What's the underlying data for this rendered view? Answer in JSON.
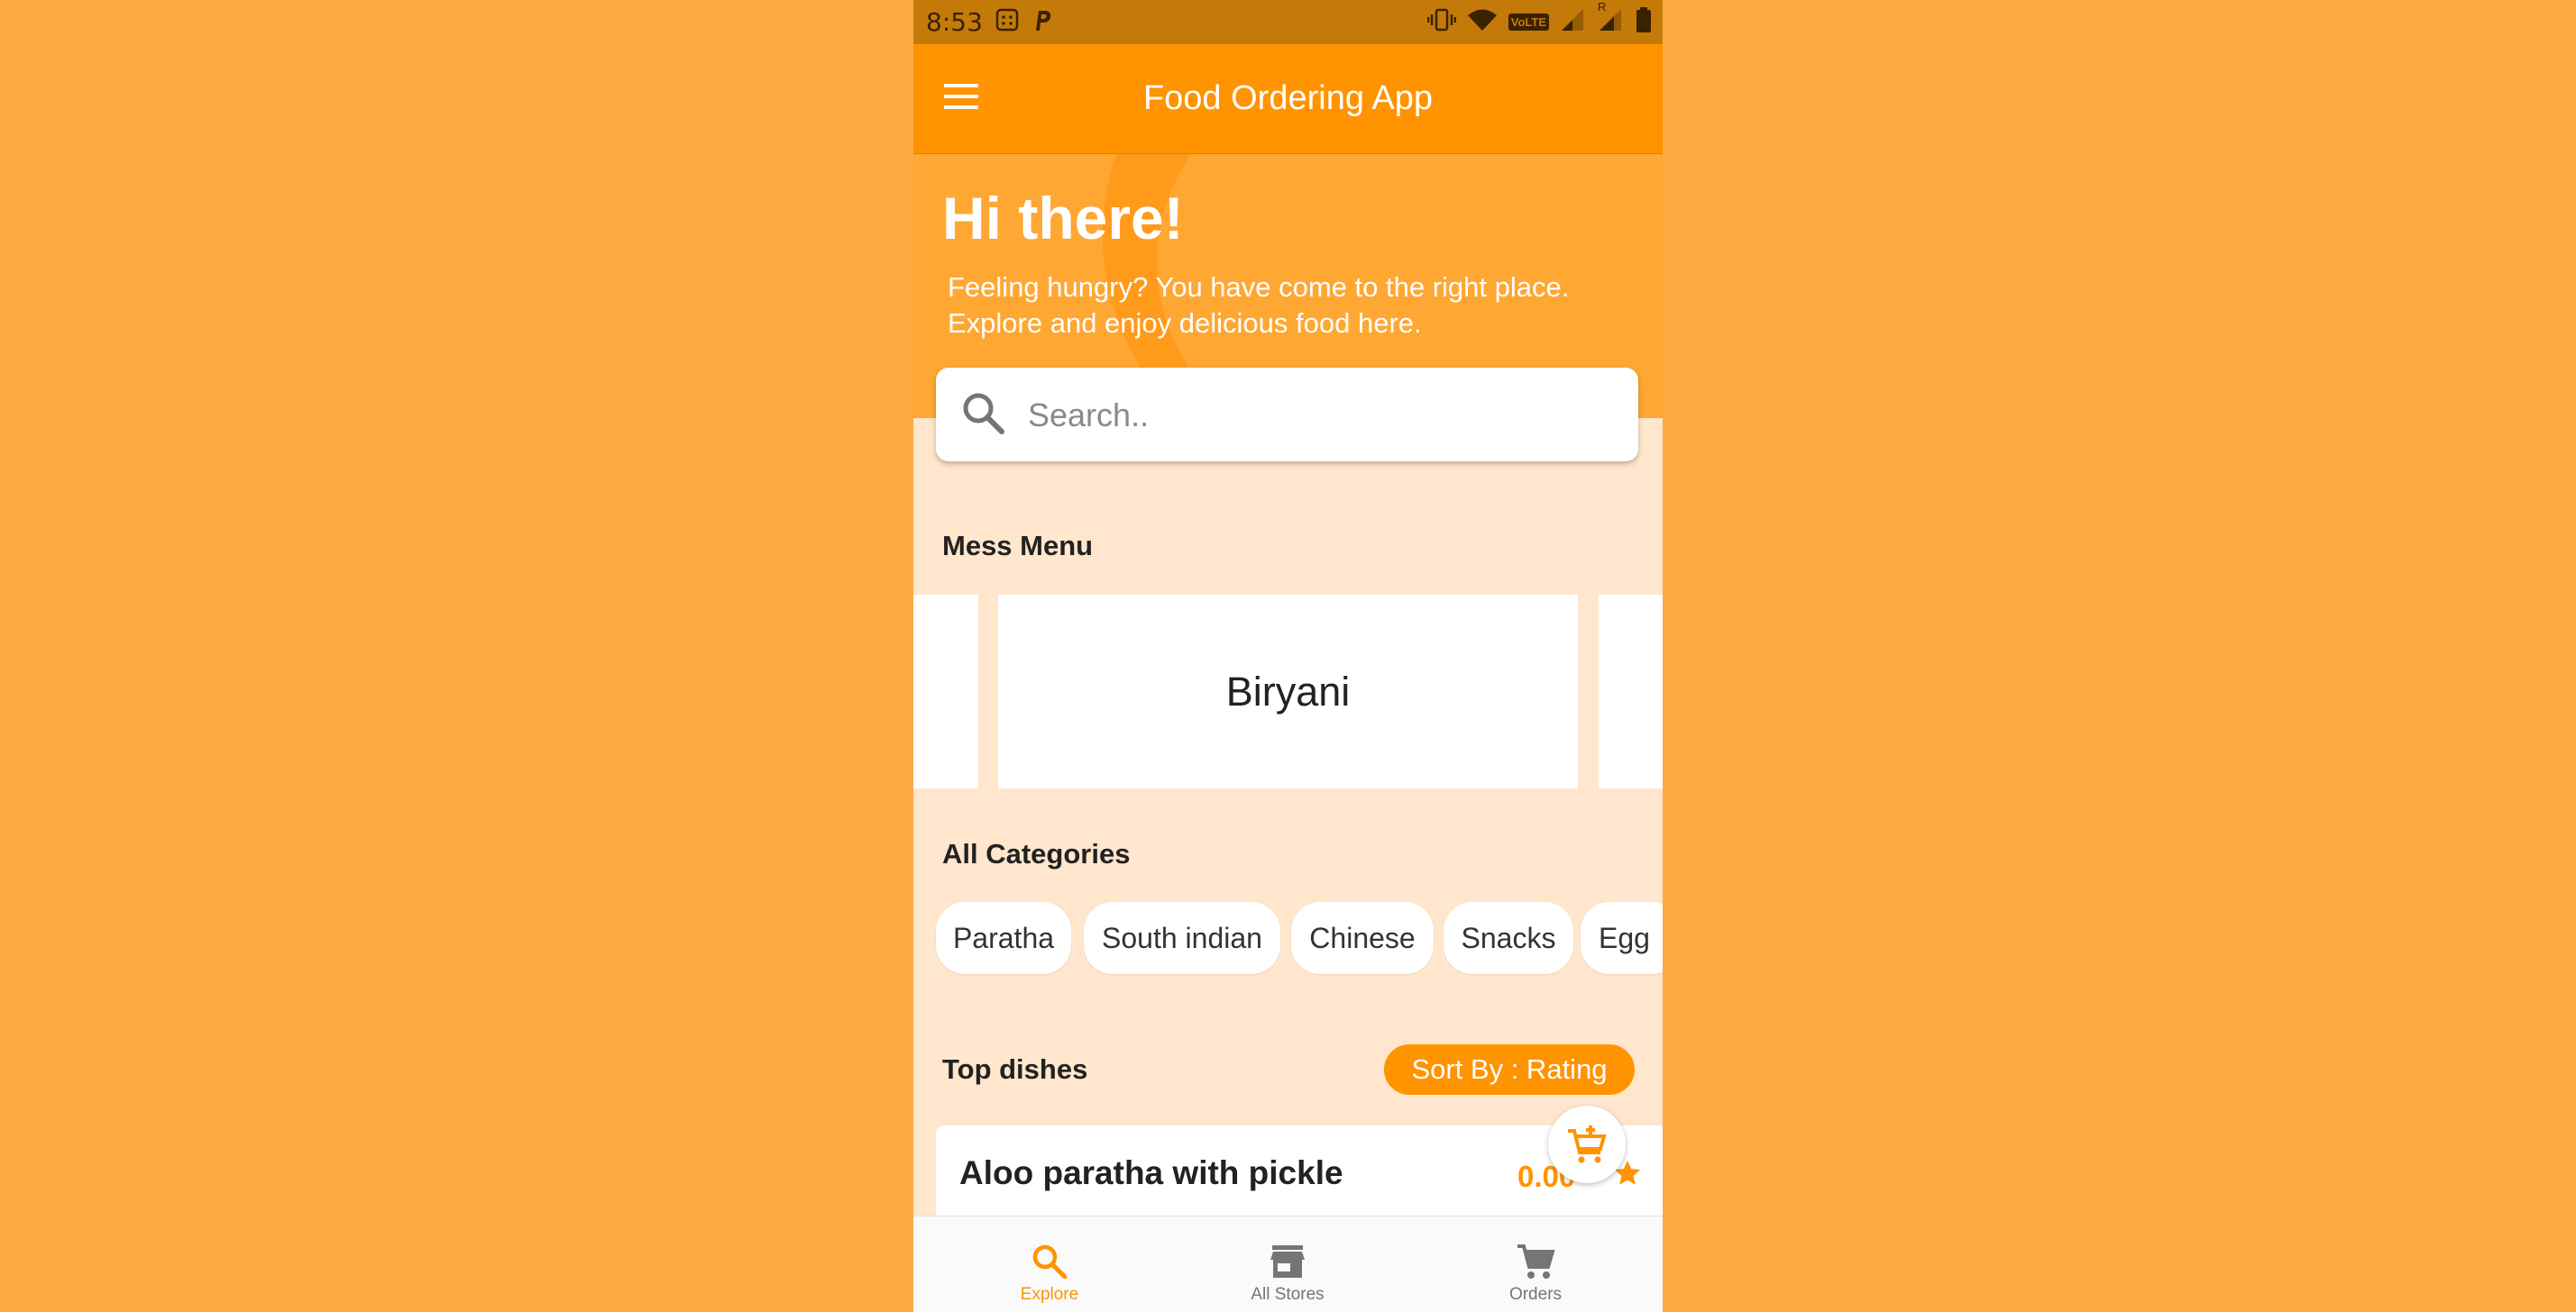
{
  "status_bar": {
    "time": "8:53",
    "network_label": "VoLTE",
    "roaming": "R"
  },
  "app_bar": {
    "title": "Food Ordering App"
  },
  "hero": {
    "title": "Hi there!",
    "subtitle": "Feeling hungry? You have come to the right place. Explore and enjoy delicious food here."
  },
  "search": {
    "placeholder": "Search..",
    "value": ""
  },
  "mess_menu": {
    "title": "Mess Menu",
    "items": [
      "Biryani"
    ]
  },
  "categories": {
    "title": "All Categories",
    "items": [
      "Paratha",
      "South indian",
      "Chinese",
      "Snacks",
      "Egg"
    ]
  },
  "top_dishes": {
    "title": "Top dishes",
    "sort_label": "Sort By : Rating",
    "items": [
      {
        "name": "Aloo paratha with pickle",
        "rating": "0.00"
      }
    ]
  },
  "bottom_nav": {
    "items": [
      {
        "label": "Explore",
        "icon": "search-icon",
        "active": true
      },
      {
        "label": "All Stores",
        "icon": "store-icon",
        "active": false
      },
      {
        "label": "Orders",
        "icon": "cart-icon",
        "active": false
      }
    ]
  },
  "colors": {
    "primary": "#FF9300",
    "hero": "#FFA733",
    "background": "#FFE6CC",
    "status_bar": "#C47A08"
  }
}
